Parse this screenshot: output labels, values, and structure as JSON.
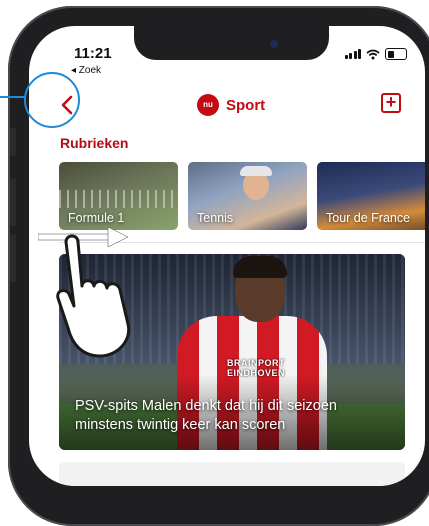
{
  "status_bar": {
    "time": "11:21",
    "back_app_label": "◂ Zoek"
  },
  "nav_bar": {
    "back_icon": "chevron-left-icon",
    "logo_text": "nu\nSPORT",
    "title": "Sport",
    "add_icon": "plus-square-icon",
    "accent_color": "#c30b14"
  },
  "section": {
    "label": "Rubrieken"
  },
  "categories": [
    {
      "label": "Formule 1"
    },
    {
      "label": "Tennis"
    },
    {
      "label": "Tour de France"
    }
  ],
  "article": {
    "headline": "PSV-spits Malen denkt dat hij dit seizoen minstens twintig keer kan scoren",
    "shirt_text": "BRAINPORT\nEINDHOVEN"
  },
  "overlay": {
    "highlight_color": "#1f8ad8",
    "gesture": "swipe-right"
  }
}
